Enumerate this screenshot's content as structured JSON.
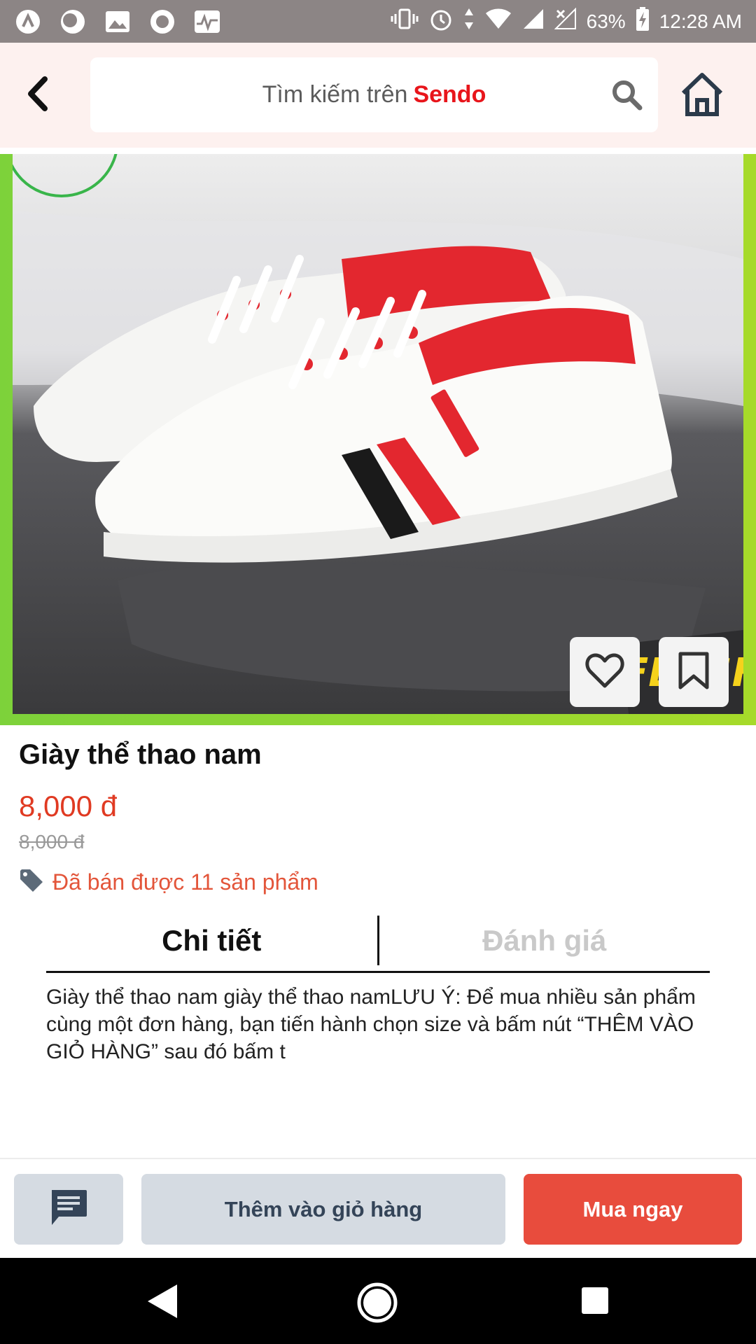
{
  "status_bar": {
    "battery": "63%",
    "time": "12:28 AM",
    "icons": [
      "app-icon",
      "moon-icon",
      "image-icon",
      "record-icon",
      "pulse-icon",
      "vibrate-icon",
      "alarm-icon",
      "data-icon",
      "wifi-icon",
      "signal-icon",
      "signal-off-icon",
      "battery-charging-icon"
    ]
  },
  "header": {
    "search_placeholder": "Tìm kiếm trên",
    "search_brand": "Sendo",
    "back_icon": "chevron-left-icon",
    "search_icon": "search-icon",
    "home_icon": "home-icon"
  },
  "product": {
    "image_text": "FLASH",
    "title": "Giày thể thao nam",
    "price": "8,000 đ",
    "old_price": "8,000 đ",
    "sold_text": "Đã bán được 11 sản phẩm",
    "favorite_icon": "heart-icon",
    "bookmark_icon": "bookmark-icon",
    "tag_icon": "tag-icon"
  },
  "tabs": [
    {
      "label": "Chi tiết",
      "active": true
    },
    {
      "label": "Đánh giá",
      "active": false
    }
  ],
  "description": "Giày thể thao nam giày thể thao namLƯU Ý: Để mua nhiều sản phẩm cùng một đơn hàng, bạn tiến hành chọn size và bấm nút “THÊM VÀO GIỎ HÀNG” sau đó bấm t",
  "actions": {
    "chat_icon": "chat-icon",
    "add_to_cart": "Thêm vào giỏ hàng",
    "buy_now": "Mua ngay"
  },
  "colors": {
    "accent_red": "#e84c3d",
    "brand_red": "#e8151b",
    "price_red": "#e03a22",
    "cart_button_bg": "#d5dbe2",
    "header_bg": "#fdf1ef"
  }
}
